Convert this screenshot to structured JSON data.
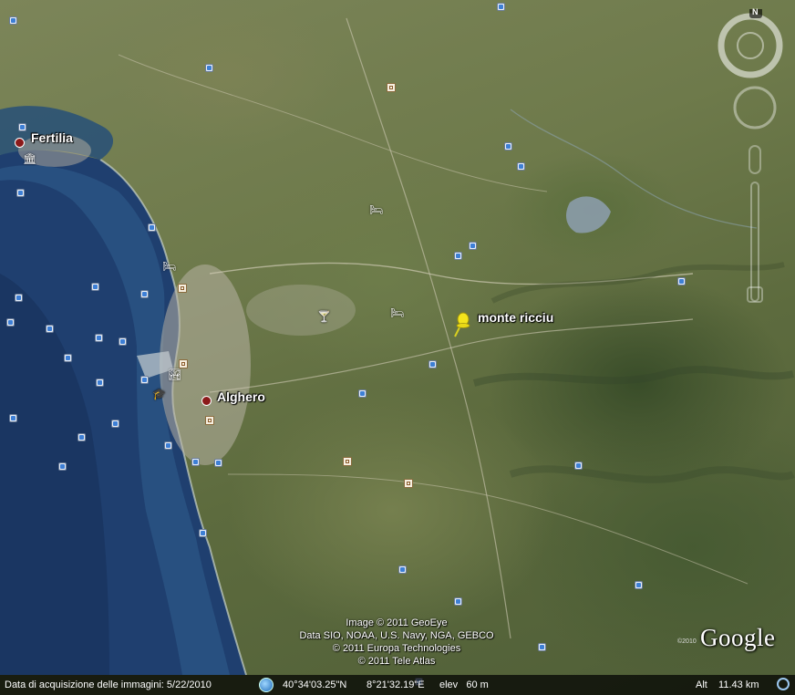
{
  "map": {
    "places": [
      {
        "name": "Fertilia"
      },
      {
        "name": "Alghero"
      }
    ],
    "placemark": {
      "name": "monte ricciu"
    },
    "compass_letter": "N",
    "attribution": [
      "Image © 2011 GeoEye",
      "Data SIO, NOAA, U.S. Navy, NGA, GEBCO",
      "© 2011 Europa Technologies",
      "© 2011 Tele Atlas"
    ],
    "logo": "Google",
    "logo_year": "©2010"
  },
  "statusbar": {
    "imagery_date": "Data di acquisizione delle immagini: 5/22/2010",
    "latitude": "40°34'03.25\"N",
    "longitude": "8°21'32.19\"E",
    "elevation": "elev   60 m",
    "altitude": "Alt    11.43 km"
  },
  "colors": {
    "sea_deep": "#1d3c6e",
    "sea_shallow": "#2e5a86",
    "land": "#6e7a4b",
    "placemark": "#f3e41c",
    "town_dot": "#8b1a1a"
  }
}
